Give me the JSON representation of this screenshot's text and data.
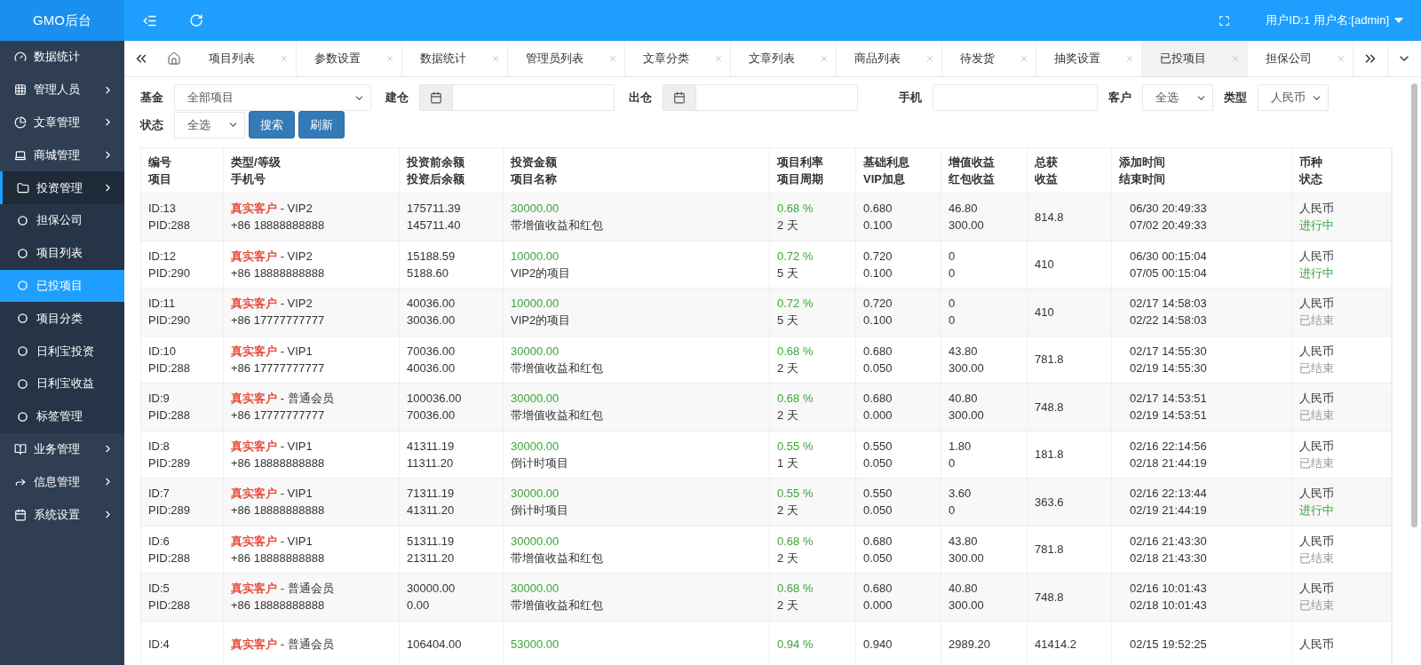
{
  "brand": "GMO后台",
  "user": "用户ID:1 用户名:[admin]",
  "sidebar": {
    "items": [
      {
        "label": "数据统计",
        "expandable": false,
        "selected": false
      },
      {
        "label": "管理人员",
        "expandable": true,
        "selected": false
      },
      {
        "label": "文章管理",
        "expandable": true,
        "selected": false
      },
      {
        "label": "商城管理",
        "expandable": true,
        "selected": false
      },
      {
        "label": "投资管理",
        "expandable": true,
        "selected": true,
        "children": [
          {
            "label": "担保公司",
            "selected": false
          },
          {
            "label": "项目列表",
            "selected": false
          },
          {
            "label": "已投项目",
            "selected": true
          },
          {
            "label": "项目分类",
            "selected": false
          },
          {
            "label": "日利宝投资",
            "selected": false
          },
          {
            "label": "日利宝收益",
            "selected": false
          },
          {
            "label": "标签管理",
            "selected": false
          }
        ]
      },
      {
        "label": "业务管理",
        "expandable": true,
        "selected": false
      },
      {
        "label": "信息管理",
        "expandable": true,
        "selected": false
      },
      {
        "label": "系统设置",
        "expandable": true,
        "selected": false
      }
    ]
  },
  "tabs": [
    {
      "label": "项目列表",
      "selected": false
    },
    {
      "label": "参数设置",
      "selected": false
    },
    {
      "label": "数据统计",
      "selected": false
    },
    {
      "label": "管理员列表",
      "selected": false
    },
    {
      "label": "文章分类",
      "selected": false
    },
    {
      "label": "文章列表",
      "selected": false
    },
    {
      "label": "商品列表",
      "selected": false
    },
    {
      "label": "待发货",
      "selected": false
    },
    {
      "label": "抽奖设置",
      "selected": false
    },
    {
      "label": "已投项目",
      "selected": true
    },
    {
      "label": "担保公司",
      "selected": false
    }
  ],
  "filters": [
    {
      "kind": "select",
      "label": "基金",
      "value": "全部项目"
    },
    {
      "kind": "date",
      "label": "建仓"
    },
    {
      "kind": "date",
      "label": "出仓"
    },
    {
      "kind": "text",
      "label": "手机"
    },
    {
      "kind": "select",
      "label": "客户",
      "value": "全选"
    },
    {
      "kind": "select",
      "label": "类型",
      "value": "人民币"
    }
  ],
  "filters_row2": {
    "label": "状态",
    "value": "全选"
  },
  "buttons": [
    "搜索",
    "刷新"
  ],
  "table": {
    "columns": [
      [
        "编号",
        "项目"
      ],
      [
        "类型/等级",
        "手机号"
      ],
      [
        "投资前余额",
        "投资后余额"
      ],
      [
        "投资金额",
        "项目名称"
      ],
      [
        "项目利率",
        "项目周期"
      ],
      [
        "基础利息",
        "VIP加息"
      ],
      [
        "增值收益",
        "红包收益"
      ],
      [
        "总获",
        "收益"
      ],
      [
        "添加时间",
        "结束时间"
      ],
      [
        "币种",
        "状态"
      ]
    ],
    "rows": [
      {
        "id": "ID:13",
        "pid": "PID:288",
        "customer": "真实客户",
        "level": "- VIP2",
        "phone": "+86 18888888888",
        "before": "175711.39",
        "after": "145711.40",
        "amount": "30000.00",
        "project": "带增值收益和红包",
        "rate": "0.68 %",
        "period": "2 天",
        "base": "0.680",
        "vip": "0.100",
        "increment": "46.80",
        "redpacket": "300.00",
        "total": "814.8",
        "start": "06/30 20:49:33",
        "end": "07/02 20:49:33",
        "currency": "人民币",
        "status": "进行中",
        "ongoing": true
      },
      {
        "id": "ID:12",
        "pid": "PID:290",
        "customer": "真实客户",
        "level": "- VIP2",
        "phone": "+86 18888888888",
        "before": "15188.59",
        "after": "5188.60",
        "amount": "10000.00",
        "project": "VIP2的项目",
        "rate": "0.72 %",
        "period": "5 天",
        "base": "0.720",
        "vip": "0.100",
        "increment": "0",
        "redpacket": "0",
        "total": "410",
        "start": "06/30 00:15:04",
        "end": "07/05 00:15:04",
        "currency": "人民币",
        "status": "进行中",
        "ongoing": true
      },
      {
        "id": "ID:11",
        "pid": "PID:290",
        "customer": "真实客户",
        "level": "- VIP2",
        "phone": "+86 17777777777",
        "before": "40036.00",
        "after": "30036.00",
        "amount": "10000.00",
        "project": "VIP2的项目",
        "rate": "0.72 %",
        "period": "5 天",
        "base": "0.720",
        "vip": "0.100",
        "increment": "0",
        "redpacket": "0",
        "total": "410",
        "start": "02/17 14:58:03",
        "end": "02/22 14:58:03",
        "currency": "人民币",
        "status": "已结束",
        "ongoing": false
      },
      {
        "id": "ID:10",
        "pid": "PID:288",
        "customer": "真实客户",
        "level": "- VIP1",
        "phone": "+86 17777777777",
        "before": "70036.00",
        "after": "40036.00",
        "amount": "30000.00",
        "project": "带增值收益和红包",
        "rate": "0.68 %",
        "period": "2 天",
        "base": "0.680",
        "vip": "0.050",
        "increment": "43.80",
        "redpacket": "300.00",
        "total": "781.8",
        "start": "02/17 14:55:30",
        "end": "02/19 14:55:30",
        "currency": "人民币",
        "status": "已结束",
        "ongoing": false
      },
      {
        "id": "ID:9",
        "pid": "PID:288",
        "customer": "真实客户",
        "level": "- 普通会员",
        "phone": "+86 17777777777",
        "before": "100036.00",
        "after": "70036.00",
        "amount": "30000.00",
        "project": "带增值收益和红包",
        "rate": "0.68 %",
        "period": "2 天",
        "base": "0.680",
        "vip": "0.000",
        "increment": "40.80",
        "redpacket": "300.00",
        "total": "748.8",
        "start": "02/17 14:53:51",
        "end": "02/19 14:53:51",
        "currency": "人民币",
        "status": "已结束",
        "ongoing": false
      },
      {
        "id": "ID:8",
        "pid": "PID:289",
        "customer": "真实客户",
        "level": "- VIP1",
        "phone": "+86 18888888888",
        "before": "41311.19",
        "after": "11311.20",
        "amount": "30000.00",
        "project": "倒计时项目",
        "rate": "0.55 %",
        "period": "1 天",
        "base": "0.550",
        "vip": "0.050",
        "increment": "1.80",
        "redpacket": "0",
        "total": "181.8",
        "start": "02/16 22:14:56",
        "end": "02/18 21:44:19",
        "currency": "人民币",
        "status": "已结束",
        "ongoing": false
      },
      {
        "id": "ID:7",
        "pid": "PID:289",
        "customer": "真实客户",
        "level": "- VIP1",
        "phone": "+86 18888888888",
        "before": "71311.19",
        "after": "41311.20",
        "amount": "30000.00",
        "project": "倒计时项目",
        "rate": "0.55 %",
        "period": "2 天",
        "base": "0.550",
        "vip": "0.050",
        "increment": "3.60",
        "redpacket": "0",
        "total": "363.6",
        "start": "02/16 22:13:44",
        "end": "02/19 21:44:19",
        "currency": "人民币",
        "status": "进行中",
        "ongoing": true
      },
      {
        "id": "ID:6",
        "pid": "PID:288",
        "customer": "真实客户",
        "level": "- VIP1",
        "phone": "+86 18888888888",
        "before": "51311.19",
        "after": "21311.20",
        "amount": "30000.00",
        "project": "带增值收益和红包",
        "rate": "0.68 %",
        "period": "2 天",
        "base": "0.680",
        "vip": "0.050",
        "increment": "43.80",
        "redpacket": "300.00",
        "total": "781.8",
        "start": "02/16 21:43:30",
        "end": "02/18 21:43:30",
        "currency": "人民币",
        "status": "已结束",
        "ongoing": false
      },
      {
        "id": "ID:5",
        "pid": "PID:288",
        "customer": "真实客户",
        "level": "- 普通会员",
        "phone": "+86 18888888888",
        "before": "30000.00",
        "after": "0.00",
        "amount": "30000.00",
        "project": "带增值收益和红包",
        "rate": "0.68 %",
        "period": "2 天",
        "base": "0.680",
        "vip": "0.000",
        "increment": "40.80",
        "redpacket": "300.00",
        "total": "748.8",
        "start": "02/16 10:01:43",
        "end": "02/18 10:01:43",
        "currency": "人民币",
        "status": "已结束",
        "ongoing": false
      },
      {
        "id": "ID:4",
        "customer": "真实客户",
        "level": "- 普通会员",
        "before": "106404.00",
        "amount": "53000.00",
        "rate": "0.94 %",
        "base": "0.940",
        "increment": "2989.20",
        "total": "41414.2",
        "start": "02/15 19:52:25",
        "currency": "人民币"
      }
    ]
  }
}
